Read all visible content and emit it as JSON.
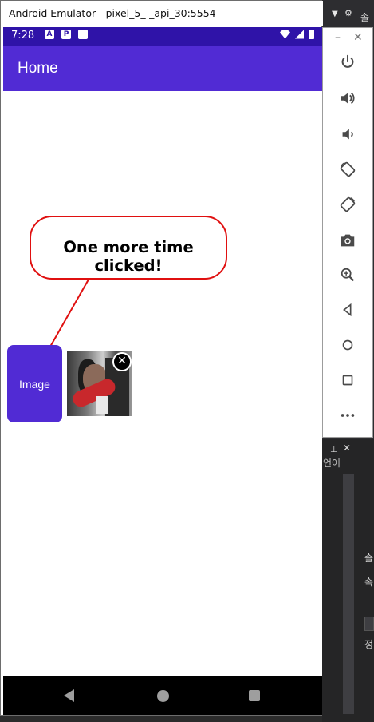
{
  "window": {
    "title": "Android Emulator - pixel_5_-_api_30:5554"
  },
  "status_bar": {
    "time": "7:28",
    "icons": [
      "A",
      "P",
      ""
    ]
  },
  "app_bar": {
    "title": "Home"
  },
  "content": {
    "callout_text": "One more time clicked!",
    "image_button_label": "Image",
    "remove_badge": "✕"
  },
  "ide": {
    "top_text": "솔",
    "panel_text": "언어",
    "side_1": "솔",
    "side_2": "속",
    "side_3": "정"
  },
  "colors": {
    "status_bar": "#2f13a8",
    "app_bar": "#512bd4",
    "image_button": "#512bd4",
    "callout_border": "#e01010",
    "arrow": "#e01010"
  },
  "controls": [
    {
      "name": "power-icon"
    },
    {
      "name": "volume-up-icon"
    },
    {
      "name": "volume-down-icon"
    },
    {
      "name": "rotate-left-icon"
    },
    {
      "name": "rotate-right-icon"
    },
    {
      "name": "camera-icon"
    },
    {
      "name": "zoom-icon"
    },
    {
      "name": "back-icon"
    },
    {
      "name": "home-icon"
    },
    {
      "name": "overview-icon"
    },
    {
      "name": "more-icon"
    }
  ]
}
